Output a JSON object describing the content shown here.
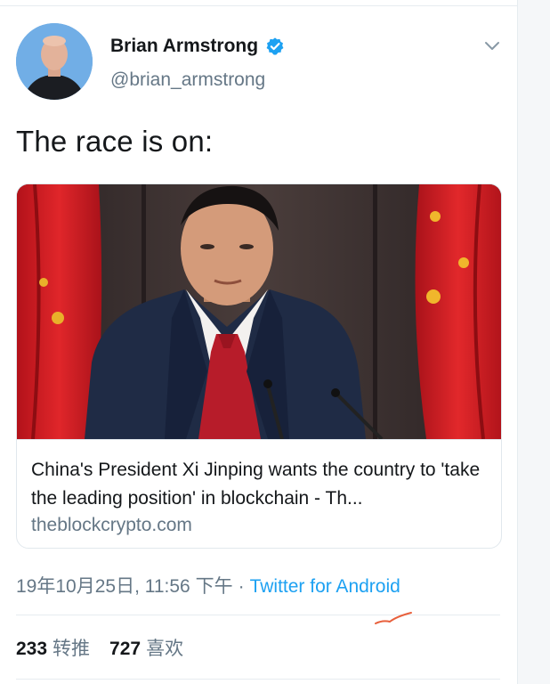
{
  "author": {
    "display_name": "Brian Armstrong",
    "handle": "@brian_armstrong",
    "verified_icon": "verified-badge-icon",
    "menu_icon": "chevron-down-icon"
  },
  "tweet": {
    "text": "The race is on:"
  },
  "card": {
    "title": "China's President Xi Jinping wants the country to 'take the leading position' in blockchain - Th...",
    "domain": "theblockcrypto.com"
  },
  "meta": {
    "timestamp": "19年10月25日, 11:56 下午",
    "separator": "·",
    "source": "Twitter for Android"
  },
  "stats": {
    "retweets_count": "233",
    "retweets_label": "转推",
    "likes_count": "727",
    "likes_label": "喜欢"
  },
  "colors": {
    "link": "#1da1f2",
    "secondary_text": "#657786",
    "primary_text": "#14171a",
    "border": "#e1e8ed"
  }
}
